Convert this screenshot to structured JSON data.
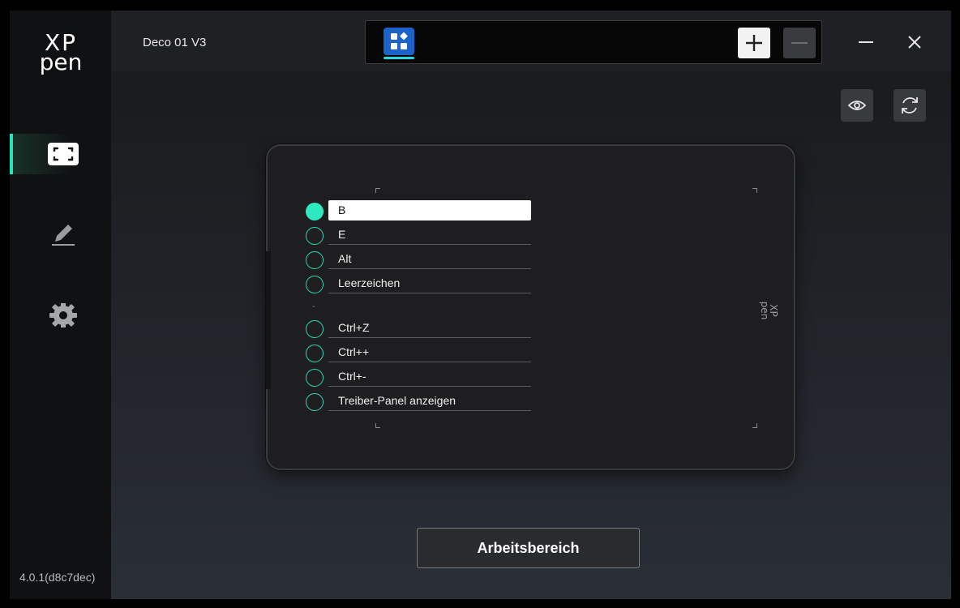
{
  "sidebar": {
    "logo_top": "XP",
    "logo_bottom": "pen",
    "items": [
      {
        "name": "working-area",
        "icon": "fullscreen-frame-icon",
        "active": true
      },
      {
        "name": "pen",
        "icon": "pen-icon",
        "active": false
      },
      {
        "name": "settings",
        "icon": "gear-icon",
        "active": false
      }
    ],
    "version": "4.0.1(d8c7dec)"
  },
  "titlebar": {
    "device_name": "Deco 01 V3",
    "app_tab_icon": "apps-grid-icon",
    "add_icon": "plus-icon",
    "remove_icon": "minus-icon",
    "minimize_icon": "minimize-icon",
    "close_icon": "close-icon"
  },
  "toolbar": {
    "preview_icon": "eye-icon",
    "refresh_icon": "refresh-icon"
  },
  "tablet": {
    "logo_top": "XP",
    "logo_bottom": "pen",
    "keys_top": [
      {
        "label": "B",
        "selected": true
      },
      {
        "label": "E",
        "selected": false
      },
      {
        "label": "Alt",
        "selected": false
      },
      {
        "label": "Leerzeichen",
        "selected": false
      }
    ],
    "separator": "-",
    "keys_bottom": [
      {
        "label": "Ctrl+Z",
        "selected": false
      },
      {
        "label": "Ctrl++",
        "selected": false
      },
      {
        "label": "Ctrl+-",
        "selected": false
      },
      {
        "label": "Treiber-Panel anzeigen",
        "selected": false
      }
    ]
  },
  "footer": {
    "workarea_button": "Arbeitsbereich"
  },
  "colors": {
    "accent": "#2ee8c0",
    "app_tile": "#1c63c9",
    "background": "#1b1c1f"
  }
}
